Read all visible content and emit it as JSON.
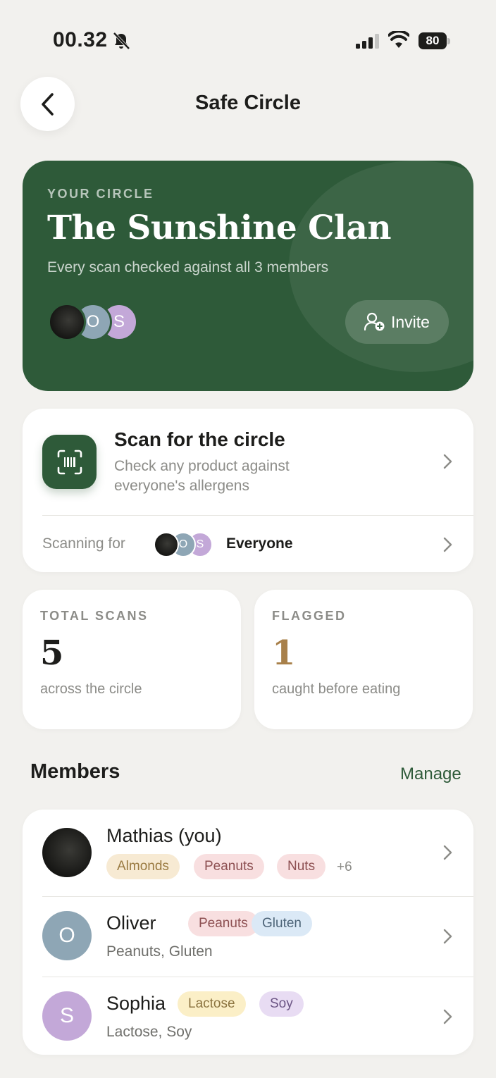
{
  "status_bar": {
    "time": "00.32",
    "battery": "80"
  },
  "header": {
    "title": "Safe Circle"
  },
  "hero": {
    "eyebrow": "YOUR CIRCLE",
    "title": "The Sunshine Clan",
    "subtitle": "Every scan checked against all 3 members",
    "avatars": [
      "O",
      "S"
    ],
    "invite_label": "Invite"
  },
  "scan": {
    "title": "Scan for the circle",
    "subtitle": "Check any product against everyone's allergens",
    "scanning_label": "Scanning for",
    "scanning_avatars": [
      "O",
      "S"
    ],
    "scanning_value": "Everyone"
  },
  "stats": {
    "total": {
      "label": "TOTAL SCANS",
      "value": "5",
      "caption": "across the circle"
    },
    "flagged": {
      "label": "FLAGGED",
      "value": "1",
      "caption": "caught before eating"
    }
  },
  "members": {
    "title": "Members",
    "manage_label": "Manage",
    "items": [
      {
        "name": "Mathias (you)",
        "tags": [
          "Almonds",
          "Peanuts",
          "Nuts"
        ],
        "more": "+6"
      },
      {
        "name": "Oliver",
        "initial": "O",
        "tags": [
          "Peanuts",
          "Gluten"
        ],
        "summary": "Peanuts, Gluten"
      },
      {
        "name": "Sophia",
        "initial": "S",
        "tags": [
          "Lactose",
          "Soy"
        ],
        "summary": "Lactose, Soy"
      }
    ]
  },
  "colors": {
    "accent": "#2e5a39",
    "flagged": "#a8804a",
    "background": "#f2f1ee"
  },
  "icons": [
    "bell-slash-icon",
    "signal-icon",
    "wifi-icon",
    "back-chevron-icon",
    "add-user-icon",
    "barcode-scan-icon",
    "chevron-right-icon"
  ]
}
